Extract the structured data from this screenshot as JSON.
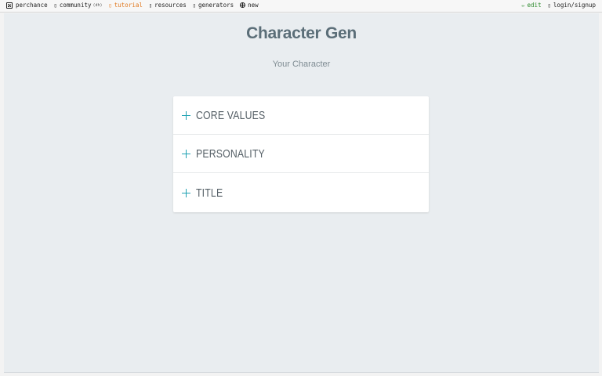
{
  "nav": {
    "left": [
      {
        "label": "perchance",
        "icon": "dice-icon"
      },
      {
        "label": "community",
        "suffix": "(dh)",
        "icon": "chat-icon"
      },
      {
        "label": "tutorial",
        "icon": "book-icon"
      },
      {
        "label": "resources",
        "icon": "folder-icon"
      },
      {
        "label": "generators",
        "icon": "list-icon"
      },
      {
        "label": "new",
        "icon": "globe-icon"
      }
    ],
    "right": [
      {
        "label": "edit",
        "icon": "pencil-icon"
      },
      {
        "label": "login/signup",
        "icon": "user-icon"
      }
    ]
  },
  "page": {
    "title": "Character Gen",
    "subtitle": "Your Character"
  },
  "accordion": [
    {
      "label": "CORE VALUES"
    },
    {
      "label": "PERSONALITY"
    },
    {
      "label": "TITLE"
    }
  ],
  "colors": {
    "accent": "#1fa2b3",
    "tutorial": "#e0781e",
    "edit": "#2e8b2e",
    "panel_bg": "#e9edf0",
    "title": "#5b6e78"
  }
}
